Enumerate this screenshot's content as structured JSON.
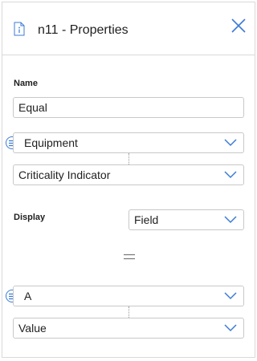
{
  "header": {
    "title": "n11 - Properties",
    "icons": {
      "document": "document-info-icon",
      "close": "close-icon"
    }
  },
  "name_section": {
    "label": "Name",
    "value": "Equal"
  },
  "first_expression": {
    "family": "Equipment",
    "field": "Criticality Indicator"
  },
  "display": {
    "label": "Display",
    "value": "Field"
  },
  "operator": {
    "symbol_icon": "equals-icon"
  },
  "second_expression": {
    "family": "A",
    "field": "Value"
  },
  "colors": {
    "accent": "#3b7bd6",
    "border": "#c8c8c8",
    "text": "#1f1f1f"
  }
}
